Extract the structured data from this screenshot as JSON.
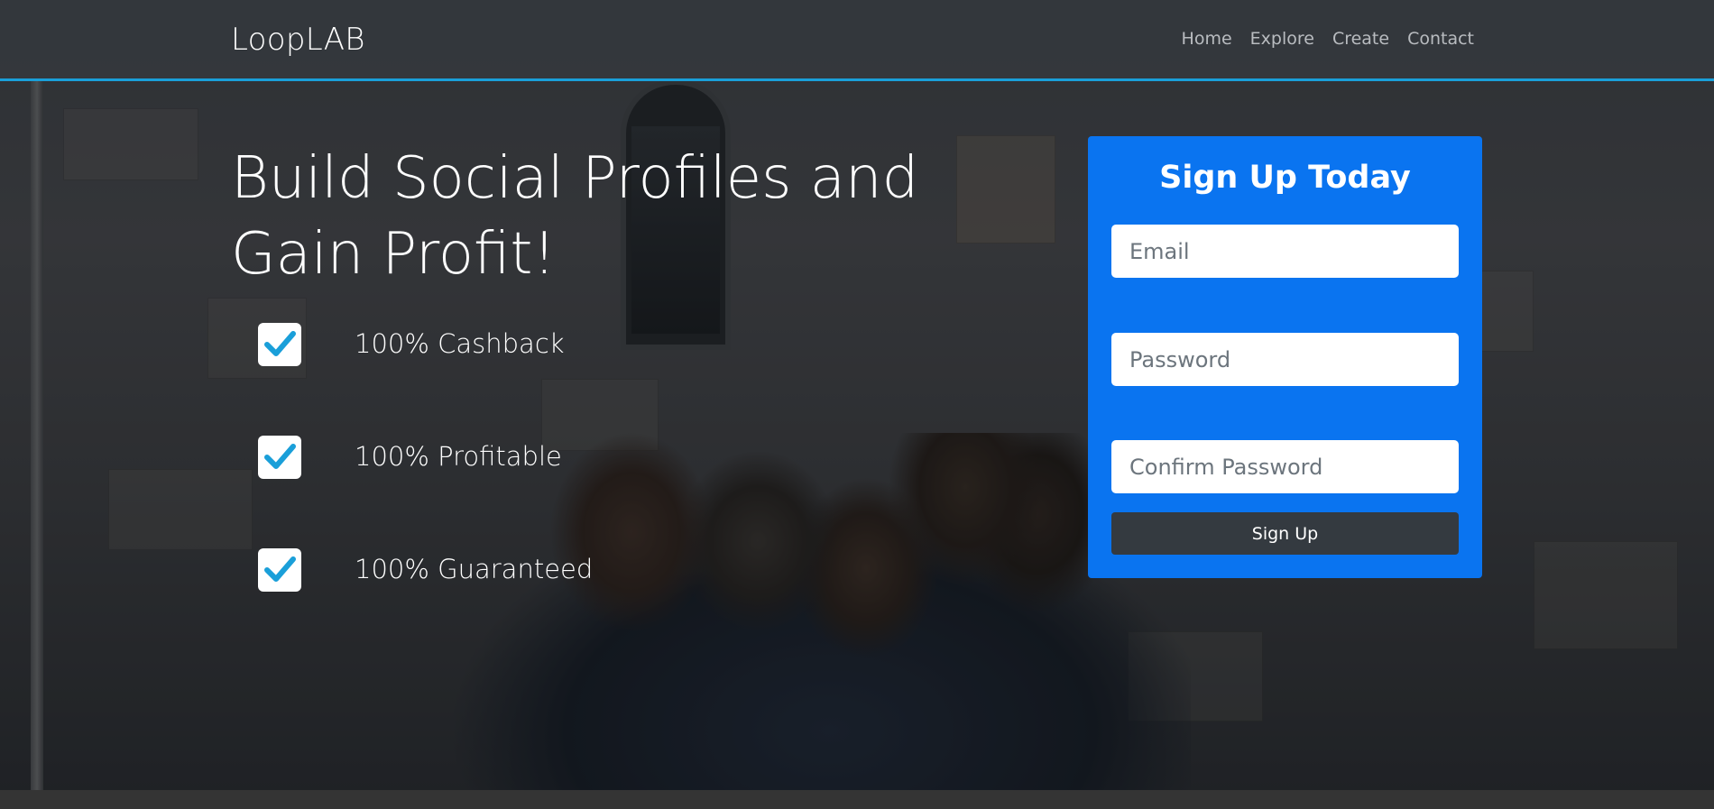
{
  "brand": "LoopLAB",
  "nav": {
    "items": [
      "Home",
      "Explore",
      "Create",
      "Contact"
    ]
  },
  "hero": {
    "headline": "Build Social Profiles and Gain Profit!",
    "features": [
      "100% Cashback",
      "100% Profitable",
      "100% Guaranteed"
    ]
  },
  "signup": {
    "title": "Sign Up Today",
    "email_placeholder": "Email",
    "password_placeholder": "Password",
    "confirm_placeholder": "Confirm Password",
    "button_label": "Sign Up"
  },
  "colors": {
    "navbar_accent": "#1a9fd9",
    "card_background": "#0a74f0",
    "button_background": "#343a40",
    "checkmark": "#1a9fd9"
  },
  "icons": {
    "feature_check": "checkbox-check-icon"
  }
}
